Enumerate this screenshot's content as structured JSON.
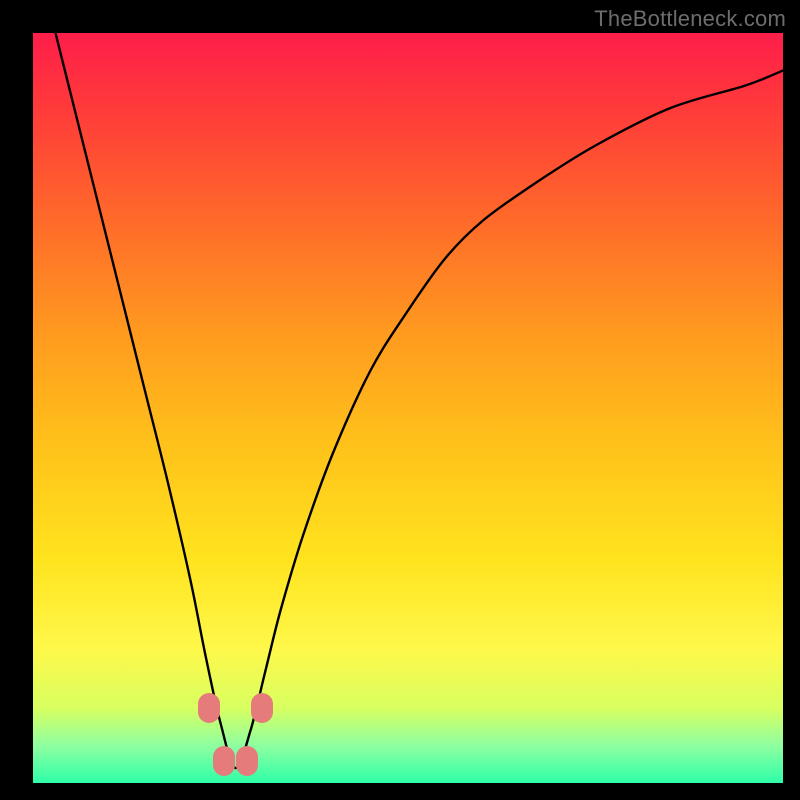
{
  "watermark": "TheBottleneck.com",
  "colors": {
    "black": "#000000",
    "curve_stroke": "#000000",
    "marker_fill": "#e67b7b",
    "gradient_stops": [
      {
        "offset": 0.0,
        "color": "#ff1e4a"
      },
      {
        "offset": 0.1,
        "color": "#ff3a3a"
      },
      {
        "offset": 0.25,
        "color": "#ff6a2a"
      },
      {
        "offset": 0.4,
        "color": "#ff9a1f"
      },
      {
        "offset": 0.55,
        "color": "#ffc21a"
      },
      {
        "offset": 0.7,
        "color": "#ffe31e"
      },
      {
        "offset": 0.82,
        "color": "#fff84a"
      },
      {
        "offset": 0.9,
        "color": "#d8ff60"
      },
      {
        "offset": 0.95,
        "color": "#8effa0"
      },
      {
        "offset": 1.0,
        "color": "#2effa8"
      }
    ]
  },
  "chart_data": {
    "type": "line",
    "title": "",
    "xlabel": "",
    "ylabel": "",
    "xlim": [
      0,
      100
    ],
    "ylim": [
      0,
      100
    ],
    "grid": false,
    "note": "x,y are in percent of the plot area; y=100 is top (max bottleneck), y=0 is bottom (min). Curve is a V-shaped bottleneck profile with minimum near x≈27.",
    "series": [
      {
        "name": "bottleneck-curve",
        "x": [
          3,
          6,
          9,
          12,
          15,
          18,
          21,
          23,
          25,
          27,
          29,
          31,
          33,
          36,
          40,
          45,
          50,
          55,
          60,
          67,
          75,
          85,
          95,
          100
        ],
        "y": [
          100,
          88,
          76,
          64,
          52,
          40,
          27,
          17,
          8,
          2,
          7,
          15,
          23,
          33,
          44,
          55,
          63,
          70,
          75,
          80,
          85,
          90,
          93,
          95
        ]
      }
    ],
    "markers": {
      "name": "highlight-dots",
      "color": "#e67b7b",
      "points": [
        {
          "x": 23.5,
          "y": 10
        },
        {
          "x": 25.5,
          "y": 3
        },
        {
          "x": 28.5,
          "y": 3
        },
        {
          "x": 30.5,
          "y": 10
        }
      ]
    }
  }
}
